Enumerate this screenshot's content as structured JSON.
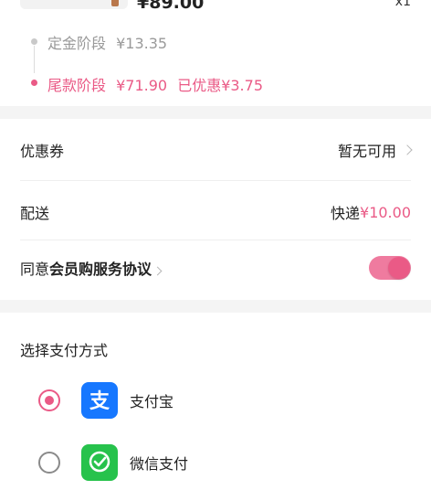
{
  "order": {
    "price": "¥89.00",
    "quantity": "x1"
  },
  "stages": [
    {
      "label": "定金阶段",
      "amount": "¥13.35",
      "extra": ""
    },
    {
      "label": "尾款阶段",
      "amount": "¥71.90",
      "extra": "已优惠¥3.75"
    }
  ],
  "coupon": {
    "label": "优惠券",
    "value": "暂无可用"
  },
  "delivery": {
    "label": "配送",
    "method": "快递",
    "fee": "¥10.00"
  },
  "agreement": {
    "prefix": "同意",
    "link": "会员购服务协议",
    "enabled": true
  },
  "payment": {
    "title": "选择支付方式",
    "methods": [
      {
        "label": "支付宝",
        "icon": "alipay-icon",
        "selected": true
      },
      {
        "label": "微信支付",
        "icon": "wechat-pay-icon",
        "selected": false
      }
    ]
  },
  "colors": {
    "accent": "#ea5a86",
    "alipay": "#1677ff",
    "wechat": "#27c24c"
  }
}
